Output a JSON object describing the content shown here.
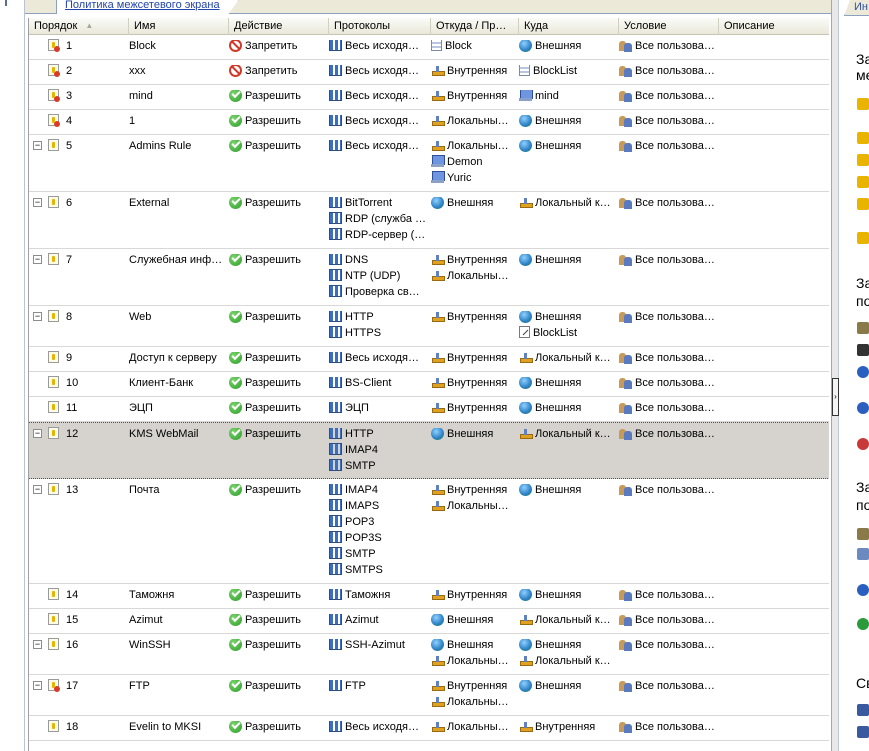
{
  "left_tab": {
    "label": "Политика межсетевого экрана"
  },
  "right_tab": {
    "label": "Ин"
  },
  "columns": [
    "Порядок",
    "Имя",
    "Действие",
    "Протоколы",
    "Откуда / Пр…",
    "Куда",
    "Условие",
    "Описание"
  ],
  "rows": [
    {
      "order": "1",
      "name": "Block",
      "action": "Запретить",
      "deny": true,
      "protocols": [
        {
          "t": "Весь исходя…",
          "i": "proto"
        }
      ],
      "from": [
        {
          "t": "Block",
          "i": "set"
        }
      ],
      "to": [
        {
          "t": "Внешняя",
          "i": "globe"
        }
      ],
      "cond": "Все пользова…"
    },
    {
      "order": "2",
      "name": "xxx",
      "action": "Запретить",
      "deny": true,
      "protocols": [
        {
          "t": "Весь исходя…",
          "i": "proto"
        }
      ],
      "from": [
        {
          "t": "Внутренняя",
          "i": "net"
        }
      ],
      "to": [
        {
          "t": "BlockList",
          "i": "set"
        }
      ],
      "cond": "Все пользова…"
    },
    {
      "order": "3",
      "name": "mind",
      "action": "Разрешить",
      "deny": false,
      "protocols": [
        {
          "t": "Весь исходя…",
          "i": "proto"
        }
      ],
      "from": [
        {
          "t": "Внутренняя",
          "i": "net"
        }
      ],
      "to": [
        {
          "t": "mind",
          "i": "pc"
        }
      ],
      "cond": "Все пользова…"
    },
    {
      "order": "4",
      "name": "1",
      "action": "Разрешить",
      "deny": false,
      "protocols": [
        {
          "t": "Весь исходя…",
          "i": "proto"
        }
      ],
      "from": [
        {
          "t": "Локальны…",
          "i": "net"
        }
      ],
      "to": [
        {
          "t": "Внешняя",
          "i": "globe"
        }
      ],
      "cond": "Все пользова…"
    },
    {
      "order": "5",
      "name": "Admins Rule",
      "action": "Разрешить",
      "deny": false,
      "expand": true,
      "protocols": [
        {
          "t": "Весь исходя…",
          "i": "proto"
        }
      ],
      "from": [
        {
          "t": "Локальны…",
          "i": "net"
        },
        {
          "t": "Demon",
          "i": "pc"
        },
        {
          "t": "Yuric",
          "i": "pc"
        }
      ],
      "to": [
        {
          "t": "Внешняя",
          "i": "globe"
        }
      ],
      "cond": "Все пользова…"
    },
    {
      "order": "6",
      "name": "External",
      "action": "Разрешить",
      "deny": false,
      "expand": true,
      "protocols": [
        {
          "t": "BitTorrent",
          "i": "proto"
        },
        {
          "t": "RDP (служба …",
          "i": "proto"
        },
        {
          "t": "RDP-сервер (…",
          "i": "proto"
        }
      ],
      "from": [
        {
          "t": "Внешняя",
          "i": "globe"
        }
      ],
      "to": [
        {
          "t": "Локальный к…",
          "i": "net"
        }
      ],
      "cond": "Все пользова…"
    },
    {
      "order": "7",
      "name": "Служебная инф…",
      "action": "Разрешить",
      "deny": false,
      "expand": true,
      "protocols": [
        {
          "t": "DNS",
          "i": "proto"
        },
        {
          "t": "NTP (UDP)",
          "i": "proto"
        },
        {
          "t": "Проверка св…",
          "i": "proto"
        }
      ],
      "from": [
        {
          "t": "Внутренняя",
          "i": "net"
        },
        {
          "t": "Локальны…",
          "i": "net"
        }
      ],
      "to": [
        {
          "t": "Внешняя",
          "i": "globe"
        }
      ],
      "cond": "Все пользова…"
    },
    {
      "order": "8",
      "name": "Web",
      "action": "Разрешить",
      "deny": false,
      "expand": true,
      "protocols": [
        {
          "t": "HTTP",
          "i": "proto"
        },
        {
          "t": "HTTPS",
          "i": "proto"
        }
      ],
      "from": [
        {
          "t": "Внутренняя",
          "i": "net"
        }
      ],
      "to": [
        {
          "t": "Внешняя",
          "i": "globe"
        },
        {
          "t": "BlockList",
          "i": "url"
        }
      ],
      "cond": "Все пользова…"
    },
    {
      "order": "9",
      "name": "Доступ к серверу",
      "action": "Разрешить",
      "deny": false,
      "protocols": [
        {
          "t": "Весь исходя…",
          "i": "proto"
        }
      ],
      "from": [
        {
          "t": "Внутренняя",
          "i": "net"
        }
      ],
      "to": [
        {
          "t": "Локальный к…",
          "i": "net"
        }
      ],
      "cond": "Все пользова…"
    },
    {
      "order": "10",
      "name": "Клиент-Банк",
      "action": "Разрешить",
      "deny": false,
      "protocols": [
        {
          "t": "BS-Client",
          "i": "proto"
        }
      ],
      "from": [
        {
          "t": "Внутренняя",
          "i": "net"
        }
      ],
      "to": [
        {
          "t": "Внешняя",
          "i": "globe"
        }
      ],
      "cond": "Все пользова…"
    },
    {
      "order": "11",
      "name": "ЭЦП",
      "action": "Разрешить",
      "deny": false,
      "protocols": [
        {
          "t": "ЭЦП",
          "i": "proto"
        }
      ],
      "from": [
        {
          "t": "Внутренняя",
          "i": "net"
        }
      ],
      "to": [
        {
          "t": "Внешняя",
          "i": "globe"
        }
      ],
      "cond": "Все пользова…"
    },
    {
      "order": "12",
      "name": "KMS WebMail",
      "action": "Разрешить",
      "deny": false,
      "expand": true,
      "selected": true,
      "protocols": [
        {
          "t": "HTTP",
          "i": "proto"
        },
        {
          "t": "IMAP4",
          "i": "proto"
        },
        {
          "t": "SMTP",
          "i": "proto"
        }
      ],
      "from": [
        {
          "t": "Внешняя",
          "i": "globe"
        }
      ],
      "to": [
        {
          "t": "Локальный к…",
          "i": "net"
        }
      ],
      "cond": "Все пользова…"
    },
    {
      "order": "13",
      "name": "Почта",
      "action": "Разрешить",
      "deny": false,
      "expand": true,
      "protocols": [
        {
          "t": "IMAP4",
          "i": "proto"
        },
        {
          "t": "IMAPS",
          "i": "proto"
        },
        {
          "t": "POP3",
          "i": "proto"
        },
        {
          "t": "POP3S",
          "i": "proto"
        },
        {
          "t": "SMTP",
          "i": "proto"
        },
        {
          "t": "SMTPS",
          "i": "proto"
        }
      ],
      "from": [
        {
          "t": "Внутренняя",
          "i": "net"
        },
        {
          "t": "Локальны…",
          "i": "net"
        }
      ],
      "to": [
        {
          "t": "Внешняя",
          "i": "globe"
        }
      ],
      "cond": "Все пользова…"
    },
    {
      "order": "14",
      "name": "Таможня",
      "action": "Разрешить",
      "deny": false,
      "protocols": [
        {
          "t": "Таможня",
          "i": "proto"
        }
      ],
      "from": [
        {
          "t": "Внутренняя",
          "i": "net"
        }
      ],
      "to": [
        {
          "t": "Внешняя",
          "i": "globe"
        }
      ],
      "cond": "Все пользова…"
    },
    {
      "order": "15",
      "name": "Azimut",
      "action": "Разрешить",
      "deny": false,
      "protocols": [
        {
          "t": "Azimut",
          "i": "proto"
        }
      ],
      "from": [
        {
          "t": "Внешняя",
          "i": "globe"
        }
      ],
      "to": [
        {
          "t": "Локальный к…",
          "i": "net"
        }
      ],
      "cond": "Все пользова…"
    },
    {
      "order": "16",
      "name": "WinSSH",
      "action": "Разрешить",
      "deny": false,
      "expand": true,
      "protocols": [
        {
          "t": "SSH-Azimut",
          "i": "proto"
        }
      ],
      "from": [
        {
          "t": "Внешняя",
          "i": "globe"
        },
        {
          "t": "Локальны…",
          "i": "net"
        }
      ],
      "to": [
        {
          "t": "Внешняя",
          "i": "globe"
        },
        {
          "t": "Локальный к…",
          "i": "net"
        }
      ],
      "cond": "Все пользова…"
    },
    {
      "order": "17",
      "name": "FTP",
      "action": "Разрешить",
      "deny": false,
      "expand": true,
      "protocols": [
        {
          "t": "FTP",
          "i": "proto"
        }
      ],
      "from": [
        {
          "t": "Внутренняя",
          "i": "net"
        },
        {
          "t": "Локальны…",
          "i": "net"
        }
      ],
      "to": [
        {
          "t": "Внешняя",
          "i": "globe"
        }
      ],
      "cond": "Все пользова…"
    },
    {
      "order": "18",
      "name": "Evelin to MKSI",
      "action": "Разрешить",
      "deny": false,
      "protocols": [
        {
          "t": "Весь исходя…",
          "i": "proto"
        }
      ],
      "from": [
        {
          "t": "Локальны…",
          "i": "net"
        }
      ],
      "to": [
        {
          "t": "Внутренняя",
          "i": "net"
        }
      ],
      "cond": "Все пользова…"
    }
  ],
  "right_panel": {
    "headings": [
      "За",
      "ме",
      "За",
      "по",
      "За",
      "по",
      "Св"
    ]
  }
}
